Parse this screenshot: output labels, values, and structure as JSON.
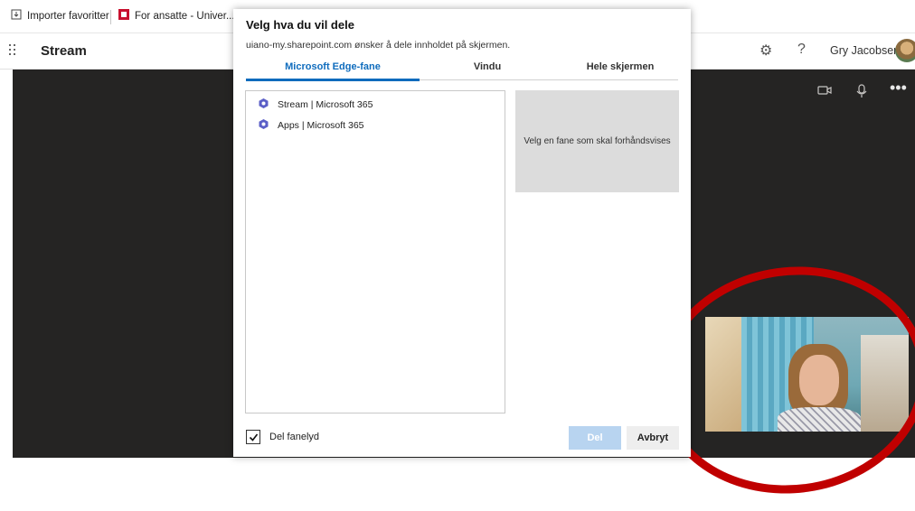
{
  "favorites": {
    "items": [
      "Importer favoritter",
      "For ansatte - Univer..."
    ]
  },
  "app": {
    "title": "Stream",
    "user_name": "Gry Jacobsen",
    "help_glyph": "?"
  },
  "dialog": {
    "title": "Velg hva du vil dele",
    "subtitle": "uiano-my.sharepoint.com ønsker å dele innholdet på skjermen.",
    "tabs": [
      "Microsoft Edge-fane",
      "Vindu",
      "Hele skjermen"
    ],
    "active_tab": 0,
    "tab_list": [
      "Stream | Microsoft 365",
      "Apps | Microsoft 365"
    ],
    "preview_text": "Velg en fane som skal forhåndsvises",
    "share_audio_label": "Del fanelyd",
    "share_audio_checked": true,
    "primary_button": "Del",
    "secondary_button": "Avbryt"
  },
  "icons": {
    "import": "import-favorites-icon",
    "site": "university-site-icon",
    "settings": "gear-icon",
    "help": "help-icon",
    "camera": "camera-icon",
    "mic": "microphone-icon",
    "more": "more-options-icon",
    "tab_item": "m365-app-icon",
    "check": "checkmark-icon"
  },
  "colors": {
    "accent": "#0f6cbd",
    "stage": "#252423",
    "annotation": "#c00000",
    "primary_disabled": "#b8d4f0"
  }
}
